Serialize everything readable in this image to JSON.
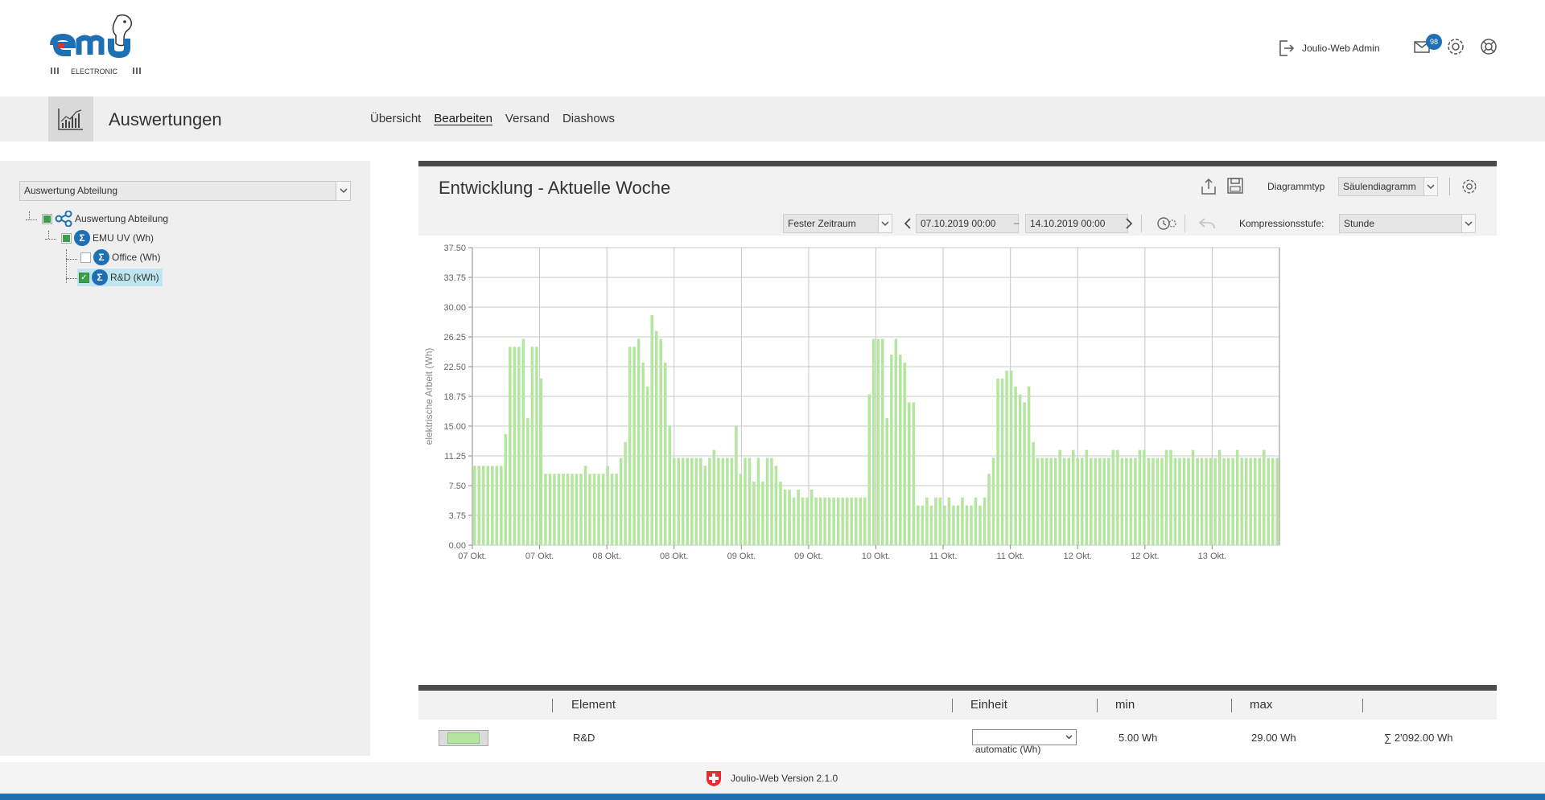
{
  "header": {
    "logo_text": "emu",
    "logo_subtext": "ELECTRONIC",
    "user_label": "Joulio-Web Admin",
    "mail_badge": "98"
  },
  "nav": {
    "title": "Auswertungen",
    "links": [
      "Übersicht",
      "Bearbeiten",
      "Versand",
      "Diashows"
    ],
    "active_link": "Bearbeiten"
  },
  "sidebar": {
    "select_value": "Auswertung Abteilung",
    "tree": [
      {
        "label": "Auswertung Abteilung",
        "icon": "share-icon",
        "check": "partial"
      },
      {
        "label": "EMU UV (Wh)",
        "icon": "sigma-icon",
        "check": "partial"
      },
      {
        "label": "Office (Wh)",
        "icon": "sigma-icon",
        "check": "unchecked"
      },
      {
        "label": "R&D (kWh)",
        "icon": "sigma-icon",
        "check": "checked",
        "selected": true
      }
    ]
  },
  "main": {
    "title": "Entwicklung - Aktuelle Woche",
    "diagram_type_label": "Diagrammtyp",
    "diagram_type_value": "Säulendiagramm",
    "period_mode": "Fester Zeitraum",
    "date_from": "07.10.2019 00:00",
    "date_sep": "–",
    "date_to": "14.10.2019 00:00",
    "compression_label": "Kompressionsstufe:",
    "compression_value": "Stunde"
  },
  "chart_data": {
    "type": "bar",
    "title": "",
    "ylabel": "elektrische Arbeit (Wh)",
    "ylim": [
      0,
      37.5
    ],
    "yticks": [
      "0.00",
      "3.75",
      "7.50",
      "11.25",
      "15.00",
      "18.75",
      "22.50",
      "26.25",
      "30.00",
      "33.75",
      "37.50"
    ],
    "xtick_labels": [
      "07 Okt.",
      "07 Okt.",
      "08 Okt.",
      "08 Okt.",
      "09 Okt.",
      "09 Okt.",
      "10 Okt.",
      "11 Okt.",
      "11 Okt.",
      "12 Okt.",
      "12 Okt.",
      "13 Okt."
    ],
    "bar_color": "#b5e6a0",
    "grid": true,
    "series": [
      {
        "name": "R&D",
        "values": [
          10,
          10,
          10,
          10,
          10,
          10,
          10,
          14,
          25,
          25,
          25,
          26,
          16,
          25,
          25,
          21,
          9,
          9,
          9,
          9,
          9,
          9,
          9,
          9,
          9,
          10,
          9,
          9,
          9,
          9,
          10,
          9,
          9,
          11,
          13,
          25,
          25,
          26,
          23,
          20,
          29,
          27,
          26,
          23,
          15,
          11,
          11,
          11,
          11,
          11,
          11,
          11,
          10,
          11,
          12,
          11,
          11,
          11,
          11,
          15,
          9,
          11,
          11,
          8,
          11,
          8,
          11,
          11,
          10,
          8,
          7,
          7,
          6,
          7,
          6,
          6,
          7,
          6,
          6,
          6,
          6,
          6,
          6,
          6,
          6,
          6,
          6,
          6,
          6,
          19,
          26,
          26,
          26,
          16,
          24,
          26,
          24,
          23,
          18,
          18,
          5,
          5,
          6,
          5,
          6,
          6,
          5,
          6,
          5,
          5,
          6,
          5,
          5,
          6,
          5,
          6,
          9,
          11,
          21,
          21,
          22,
          22,
          20,
          19,
          18,
          20,
          13,
          11,
          11,
          11,
          11,
          11,
          12,
          11,
          11,
          12,
          11,
          11,
          12,
          11,
          11,
          11,
          11,
          11,
          12,
          12,
          11,
          11,
          11,
          11,
          12,
          12,
          11,
          11,
          11,
          11,
          12,
          12,
          11,
          11,
          11,
          11,
          12,
          11,
          11,
          11,
          11,
          11,
          12,
          11,
          11,
          11,
          12,
          11,
          11,
          11,
          11,
          11,
          12,
          11,
          11,
          11
        ]
      }
    ]
  },
  "table": {
    "headers": [
      "Element",
      "Einheit",
      "min",
      "max"
    ],
    "row": {
      "element": "R&D",
      "unit": "automatic (Wh)",
      "min": "5.00 Wh",
      "max": "29.00 Wh",
      "sum": "∑ 2'092.00 Wh"
    }
  },
  "footer": {
    "version_text": "Joulio-Web Version 2.1.0"
  }
}
